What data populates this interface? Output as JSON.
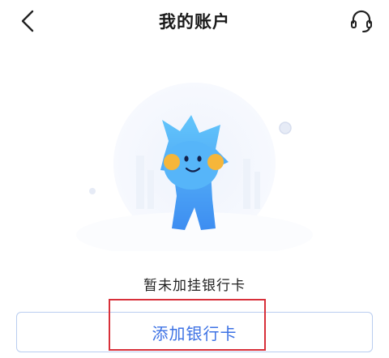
{
  "header": {
    "title": "我的账户",
    "back_icon": "chevron-left-icon",
    "support_icon": "headset-icon"
  },
  "empty_state": {
    "illustration": "mascot-illustration",
    "message": "暂未加挂银行卡"
  },
  "actions": {
    "add_card_label": "添加银行卡"
  },
  "colors": {
    "accent": "#3d72e4",
    "button_border": "#b9cdf0",
    "highlight": "#d8303a"
  }
}
